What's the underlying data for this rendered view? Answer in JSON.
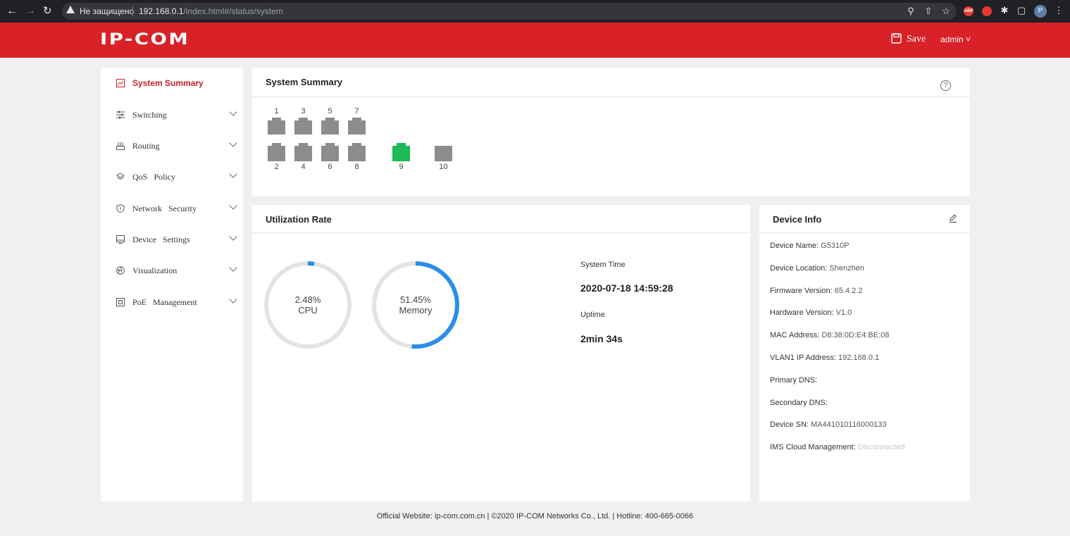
{
  "browser": {
    "insecure_label": "Не защищено",
    "url_host": "192.168.0.1",
    "url_path": "/index.html#/status/system",
    "profile_initial": "P",
    "abp_label": "ABP"
  },
  "header": {
    "logo": "IP-COM",
    "save_label": "Save",
    "user_label": "admin",
    "brand_color": "#d82228"
  },
  "sidebar": {
    "items": [
      {
        "label": "System Summary",
        "icon": "chart-icon",
        "active": true
      },
      {
        "label": "Switching",
        "icon": "sliders-icon"
      },
      {
        "label": "Routing",
        "icon": "router-icon"
      },
      {
        "label": "QoS   Policy",
        "icon": "layers-icon"
      },
      {
        "label": "Network   Security",
        "icon": "shield-icon"
      },
      {
        "label": "Device   Settings",
        "icon": "monitor-icon"
      },
      {
        "label": "Visualization",
        "icon": "aperture-icon"
      },
      {
        "label": "PoE   Management",
        "icon": "poe-icon"
      }
    ]
  },
  "summary": {
    "title": "System Summary",
    "help_symbol": "?",
    "ports": [
      {
        "num": "1",
        "status": "down"
      },
      {
        "num": "3",
        "status": "down"
      },
      {
        "num": "5",
        "status": "down"
      },
      {
        "num": "7",
        "status": "down"
      },
      {
        "num": "2",
        "status": "down"
      },
      {
        "num": "4",
        "status": "down"
      },
      {
        "num": "6",
        "status": "down"
      },
      {
        "num": "8",
        "status": "down"
      },
      {
        "num": "9",
        "status": "up"
      },
      {
        "num": "10",
        "status": "down"
      }
    ],
    "port_colors": {
      "down": "#8c8c8c",
      "up": "#1db954"
    }
  },
  "utilization": {
    "title": "Utilization Rate",
    "cpu": {
      "percent_text": "2.48%",
      "label": "CPU",
      "fraction": 0.0248
    },
    "memory": {
      "percent_text": "51.45%",
      "label": "Memory",
      "fraction": 0.5145
    },
    "gauge_color": "#2a8ee8",
    "track_color": "#e3e3e3",
    "system_time_label": "System Time",
    "system_time_value": "2020-07-18 14:59:28",
    "uptime_label": "Uptime",
    "uptime_value": "2min 34s"
  },
  "device": {
    "title": "Device Info",
    "rows": [
      {
        "label": "Device Name:",
        "value": "G5310P"
      },
      {
        "label": "Device Location:",
        "value": "Shenzhen"
      },
      {
        "label": "Firmware Version:",
        "value": "65.4.2.2"
      },
      {
        "label": "Hardware Version:",
        "value": "V1.0"
      },
      {
        "label": "MAC Address:",
        "value": "D8:38:0D:E4:BE:08"
      },
      {
        "label": "VLAN1 IP Address:",
        "value": "192.168.0.1"
      },
      {
        "label": "Primary DNS:",
        "value": ""
      },
      {
        "label": "Secondary DNS:",
        "value": ""
      },
      {
        "label": "Device SN:",
        "value": "MA441010116000133"
      },
      {
        "label": "IMS Cloud Management:",
        "value": "Disconnected"
      }
    ]
  },
  "footer": {
    "text": "Official Website: ip-com.com.cn | ©2020 IP-COM Networks Co., Ltd. | Hotline: 400-665-0066"
  }
}
